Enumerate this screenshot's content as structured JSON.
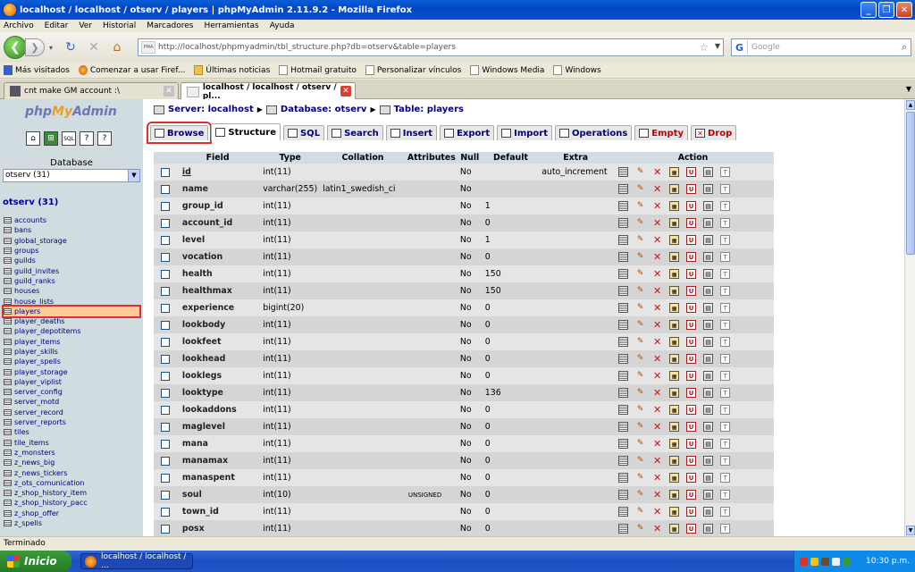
{
  "window": {
    "title": "localhost / localhost / otserv / players | phpMyAdmin 2.11.9.2 - Mozilla Firefox"
  },
  "menu": [
    "Archivo",
    "Editar",
    "Ver",
    "Historial",
    "Marcadores",
    "Herramientas",
    "Ayuda"
  ],
  "urlbar": {
    "pma_label": "PMA",
    "value": "http://localhost/phpmyadmin/tbl_structure.php?db=otserv&table=players"
  },
  "search": {
    "engine": "G",
    "placeholder": "Google"
  },
  "bookmarks": [
    "Más visitados",
    "Comenzar a usar Firef...",
    "Últimas noticias",
    "Hotmail gratuito",
    "Personalizar vínculos",
    "Windows Media",
    "Windows"
  ],
  "tabs": [
    "cnt make GM account :\\",
    "localhost / localhost / otserv / pl..."
  ],
  "sidebar": {
    "logo_php": "php",
    "logo_my": "My",
    "logo_admin": "Admin",
    "database_label": "Database",
    "db_select": "otserv (31)",
    "db_name": "otserv (31)",
    "tables": [
      "accounts",
      "bans",
      "global_storage",
      "groups",
      "guilds",
      "guild_invites",
      "guild_ranks",
      "houses",
      "house_lists",
      "players",
      "player_deaths",
      "player_depotitems",
      "player_items",
      "player_skills",
      "player_spells",
      "player_storage",
      "player_viplist",
      "server_config",
      "server_motd",
      "server_record",
      "server_reports",
      "tiles",
      "tile_items",
      "z_monsters",
      "z_news_big",
      "z_news_tickers",
      "z_ots_comunication",
      "z_shop_history_item",
      "z_shop_history_pacc",
      "z_shop_offer",
      "z_spells"
    ],
    "selected": "players"
  },
  "breadcrumb": {
    "server": "Server: localhost",
    "database": "Database: otserv",
    "table": "Table: players"
  },
  "page_tabs": [
    "Browse",
    "Structure",
    "SQL",
    "Search",
    "Insert",
    "Export",
    "Import",
    "Operations",
    "Empty",
    "Drop"
  ],
  "table": {
    "headers": [
      "Field",
      "Type",
      "Collation",
      "Attributes",
      "Null",
      "Default",
      "Extra",
      "Action"
    ],
    "rows": [
      {
        "field": "id",
        "type": "int(11)",
        "collation": "",
        "attributes": "",
        "null": "No",
        "default": "",
        "extra": "auto_increment"
      },
      {
        "field": "name",
        "type": "varchar(255)",
        "collation": "latin1_swedish_ci",
        "attributes": "",
        "null": "No",
        "default": "",
        "extra": ""
      },
      {
        "field": "group_id",
        "type": "int(11)",
        "collation": "",
        "attributes": "",
        "null": "No",
        "default": "1",
        "extra": ""
      },
      {
        "field": "account_id",
        "type": "int(11)",
        "collation": "",
        "attributes": "",
        "null": "No",
        "default": "0",
        "extra": ""
      },
      {
        "field": "level",
        "type": "int(11)",
        "collation": "",
        "attributes": "",
        "null": "No",
        "default": "1",
        "extra": ""
      },
      {
        "field": "vocation",
        "type": "int(11)",
        "collation": "",
        "attributes": "",
        "null": "No",
        "default": "0",
        "extra": ""
      },
      {
        "field": "health",
        "type": "int(11)",
        "collation": "",
        "attributes": "",
        "null": "No",
        "default": "150",
        "extra": ""
      },
      {
        "field": "healthmax",
        "type": "int(11)",
        "collation": "",
        "attributes": "",
        "null": "No",
        "default": "150",
        "extra": ""
      },
      {
        "field": "experience",
        "type": "bigint(20)",
        "collation": "",
        "attributes": "",
        "null": "No",
        "default": "0",
        "extra": ""
      },
      {
        "field": "lookbody",
        "type": "int(11)",
        "collation": "",
        "attributes": "",
        "null": "No",
        "default": "0",
        "extra": ""
      },
      {
        "field": "lookfeet",
        "type": "int(11)",
        "collation": "",
        "attributes": "",
        "null": "No",
        "default": "0",
        "extra": ""
      },
      {
        "field": "lookhead",
        "type": "int(11)",
        "collation": "",
        "attributes": "",
        "null": "No",
        "default": "0",
        "extra": ""
      },
      {
        "field": "looklegs",
        "type": "int(11)",
        "collation": "",
        "attributes": "",
        "null": "No",
        "default": "0",
        "extra": ""
      },
      {
        "field": "looktype",
        "type": "int(11)",
        "collation": "",
        "attributes": "",
        "null": "No",
        "default": "136",
        "extra": ""
      },
      {
        "field": "lookaddons",
        "type": "int(11)",
        "collation": "",
        "attributes": "",
        "null": "No",
        "default": "0",
        "extra": ""
      },
      {
        "field": "maglevel",
        "type": "int(11)",
        "collation": "",
        "attributes": "",
        "null": "No",
        "default": "0",
        "extra": ""
      },
      {
        "field": "mana",
        "type": "int(11)",
        "collation": "",
        "attributes": "",
        "null": "No",
        "default": "0",
        "extra": ""
      },
      {
        "field": "manamax",
        "type": "int(11)",
        "collation": "",
        "attributes": "",
        "null": "No",
        "default": "0",
        "extra": ""
      },
      {
        "field": "manaspent",
        "type": "int(11)",
        "collation": "",
        "attributes": "",
        "null": "No",
        "default": "0",
        "extra": ""
      },
      {
        "field": "soul",
        "type": "int(10)",
        "collation": "",
        "attributes": "UNSIGNED",
        "null": "No",
        "default": "0",
        "extra": ""
      },
      {
        "field": "town_id",
        "type": "int(11)",
        "collation": "",
        "attributes": "",
        "null": "No",
        "default": "0",
        "extra": ""
      },
      {
        "field": "posx",
        "type": "int(11)",
        "collation": "",
        "attributes": "",
        "null": "No",
        "default": "0",
        "extra": ""
      }
    ]
  },
  "statusbar": "Terminado",
  "taskbar": {
    "start": "Inicio",
    "item": "localhost / localhost / ...",
    "clock": "10:30 p.m."
  }
}
